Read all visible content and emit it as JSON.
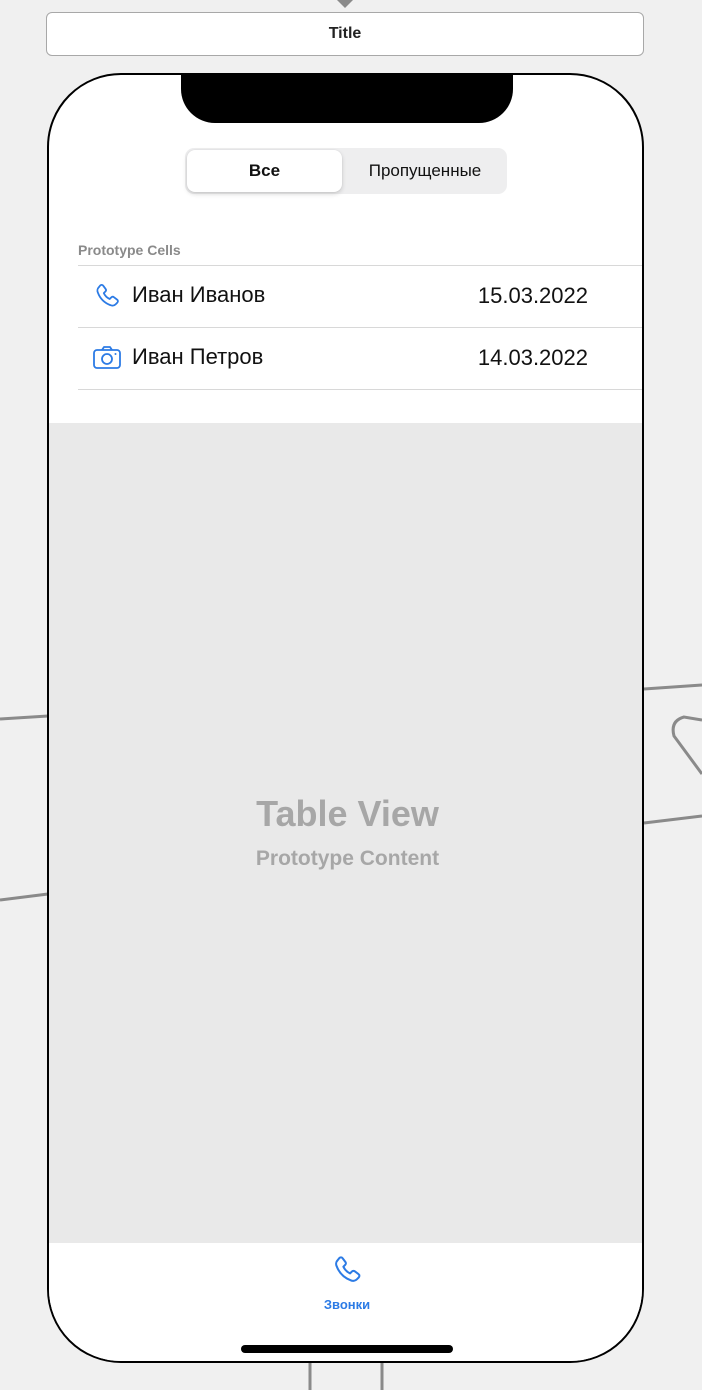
{
  "header": {
    "title": "Title"
  },
  "segmented_control": {
    "segments": [
      {
        "label": "Все",
        "selected": true
      },
      {
        "label": "Пропущенные",
        "selected": false
      }
    ]
  },
  "table": {
    "section_header": "Prototype Cells",
    "rows": [
      {
        "icon": "phone-icon",
        "name": "Иван Иванов",
        "date": "15.03.2022"
      },
      {
        "icon": "camera-icon",
        "name": "Иван Петров",
        "date": "14.03.2022"
      }
    ],
    "placeholder_title": "Table View",
    "placeholder_subtitle": "Prototype Content"
  },
  "tabbar": {
    "items": [
      {
        "icon": "phone-icon",
        "label": "Звонки",
        "selected": true
      }
    ]
  },
  "colors": {
    "accent": "#2c7be5",
    "placeholder_text": "#a7a7a7",
    "canvas_background": "#f0f0f0"
  }
}
